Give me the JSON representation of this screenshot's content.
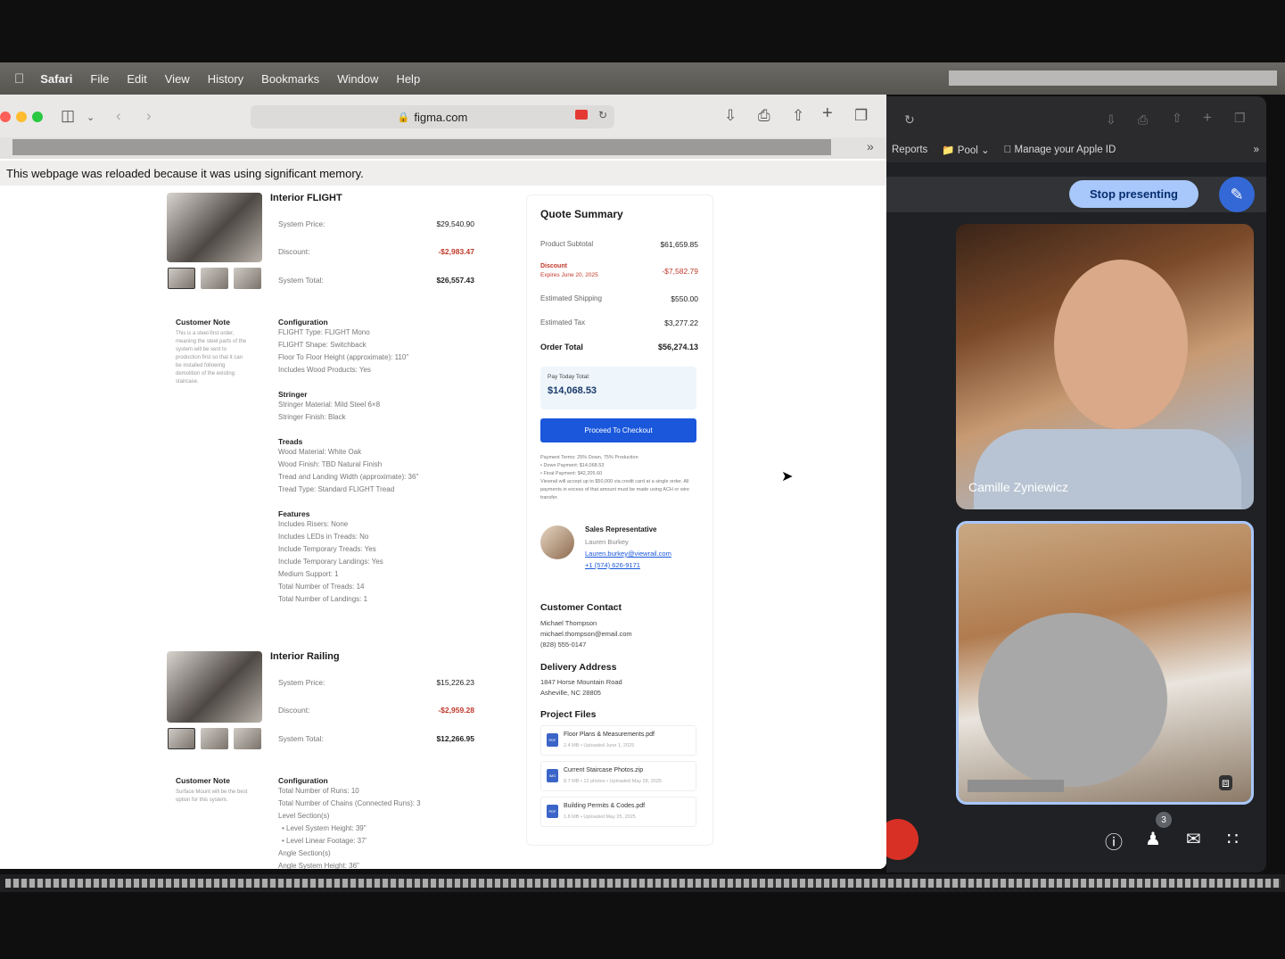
{
  "menubar": {
    "app": "Safari",
    "items": [
      "File",
      "Edit",
      "View",
      "History",
      "Bookmarks",
      "Window",
      "Help"
    ]
  },
  "safari": {
    "url": "figma.com",
    "notice": "This webpage was reloaded because it was using significant memory."
  },
  "product1": {
    "title": "Interior FLIGHT",
    "price_label": "System Price:",
    "price": "$29,540.90",
    "discount_label": "Discount:",
    "discount": "-$2,983.47",
    "total_label": "System Total:",
    "total": "$26,557.43",
    "note_title": "Customer Note",
    "note": "This is a steel-first order, meaning the steel parts of the system will be sent to production first so that it can be installed following demolition of the existing staircase.",
    "sections": [
      {
        "title": "Configuration",
        "lines": [
          "FLIGHT Type: FLIGHT Mono",
          "FLIGHT Shape: Switchback",
          "Floor To Floor Height (approximate): 110\"",
          "Includes Wood Products: Yes"
        ]
      },
      {
        "title": "Stringer",
        "lines": [
          "Stringer Material: Mild Steel 6×8",
          "Stringer Finish: Black"
        ]
      },
      {
        "title": "Treads",
        "lines": [
          "Wood Material: White Oak",
          "Wood Finish: TBD Natural Finish",
          "Tread and Landing Width (approximate): 36\"",
          "Tread Type: Standard FLIGHT Tread"
        ]
      },
      {
        "title": "Features",
        "lines": [
          "Includes Risers: None",
          "Includes LEDs in Treads: No",
          "Include Temporary Treads: Yes",
          "Include Temporary Landings: Yes",
          "Medium Support: 1",
          "Total Number of Treads: 14",
          "Total Number of Landings: 1"
        ]
      }
    ]
  },
  "product2": {
    "title": "Interior Railing",
    "price_label": "System Price:",
    "price": "$15,226.23",
    "discount_label": "Discount:",
    "discount": "-$2,959.28",
    "total_label": "System Total:",
    "total": "$12,266.95",
    "note_title": "Customer Note",
    "note": "Surface Mount will be the best option for this system.",
    "config_title": "Configuration",
    "config_lines": [
      "Total Number of Runs: 10",
      "Total Number of Chains (Connected Runs): 3",
      "Level Section(s)",
      "• Level System Height: 39\"",
      "• Level Linear Footage: 37'",
      "Angle Section(s)",
      "Angle System Height: 36\""
    ]
  },
  "quote": {
    "title": "Quote Summary",
    "subtotal_label": "Product Subtotal",
    "subtotal": "$61,659.85",
    "discount_label": "Discount",
    "discount_expires": "Expires June 20, 2025",
    "discount": "-$7,582.79",
    "shipping_label": "Estimated Shipping",
    "shipping": "$550.00",
    "tax_label": "Estimated Tax",
    "tax": "$3,277.22",
    "order_total_label": "Order Total",
    "order_total": "$56,274.13",
    "pay_today_label": "Pay Today Total:",
    "pay_today": "$14,068.53",
    "checkout_label": "Proceed To Checkout",
    "terms": [
      "Payment Terms: 25% Down, 75% Production",
      "• Down Payment: $14,068.53",
      "• Final Payment: $42,205.60",
      "Viewrail will accept up to $50,000 via credit card at a single order. All payments in excess of that amount must be made using ACH or wire transfer."
    ],
    "rep_title": "Sales Representative",
    "rep_name": "Lauren Burkey",
    "rep_email": "Lauren.burkey@viewrail.com",
    "rep_phone": "+1 (574) 626-9171",
    "contact_title": "Customer Contact",
    "contact_lines": [
      "Michael Thompson",
      "michael.thompson@email.com",
      "(828) 555-0147"
    ],
    "delivery_title": "Delivery Address",
    "delivery_lines": [
      "1847 Horse Mountain Road",
      "Asheville, NC 28805"
    ],
    "files_title": "Project Files",
    "files": [
      {
        "icon": "PDF",
        "name": "Floor Plans & Measurements.pdf",
        "meta": "2.4 MB • Uploaded June 1, 2025"
      },
      {
        "icon": "IMG",
        "name": "Current Staircase Photos.zip",
        "meta": "8.7 MB • 12 photos • Uploaded May 28, 2025"
      },
      {
        "icon": "PDF",
        "name": "Building Permits & Codes.pdf",
        "meta": "1.8 MB • Uploaded May 25, 2025"
      }
    ]
  },
  "meet": {
    "bookmarks": [
      "Reports",
      "Pool",
      "Manage your Apple ID"
    ],
    "stop_label": "Stop presenting",
    "participant1": "Camille Zyniewicz",
    "participant_count": "3"
  }
}
